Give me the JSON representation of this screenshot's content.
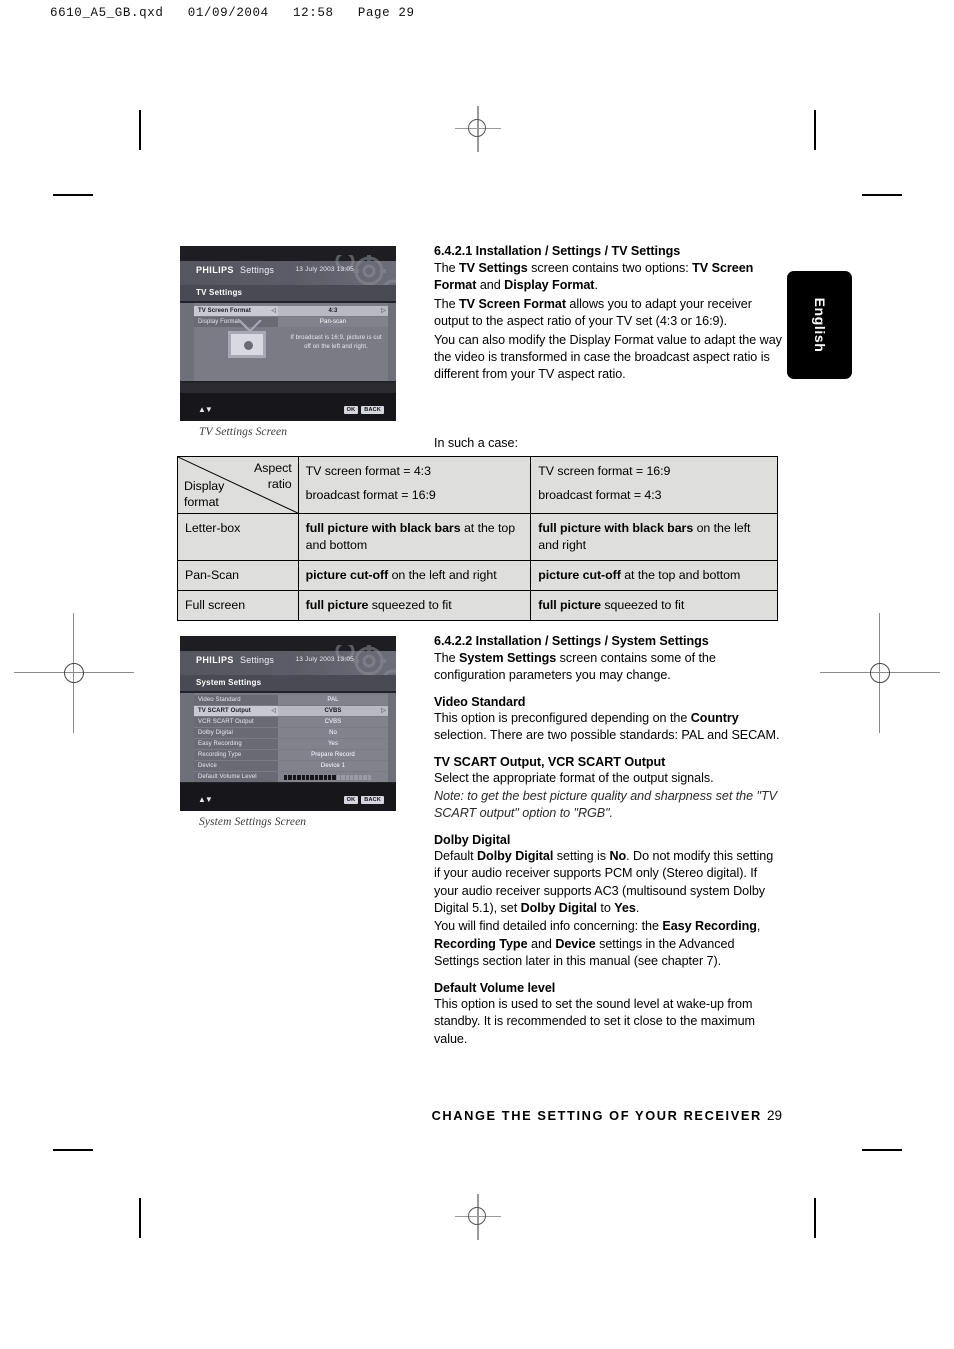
{
  "file_header": "6610_A5_GB.qxd   01/09/2004   12:58   Page 29",
  "side_tab": {
    "label": "English"
  },
  "screens": [
    {
      "brand": "PHILIPS",
      "brand_sub": "Settings",
      "datetime": "13 July 2003  13:05",
      "title": "TV Settings",
      "rows": [
        {
          "label": "TV Screen Format",
          "value": "4:3",
          "selected": true
        },
        {
          "label": "Display Format",
          "value": "Pan-scan",
          "selected": false
        }
      ],
      "hint": "If broadcast is 16:9, picture is cut off on the left and right.",
      "ok_label": "OK",
      "back_label": "BACK",
      "caption": "TV Settings Screen"
    },
    {
      "brand": "PHILIPS",
      "brand_sub": "Settings",
      "datetime": "13 July 2003  13:05",
      "title": "System Settings",
      "rows": [
        {
          "label": "Video Standard",
          "value": "PAL",
          "selected": false
        },
        {
          "label": "TV SCART Output",
          "value": "CVBS",
          "selected": true
        },
        {
          "label": "VCR SCART Output",
          "value": "CVBS",
          "selected": false
        },
        {
          "label": "Dolby Digital",
          "value": "No",
          "selected": false
        },
        {
          "label": "Easy Recording",
          "value": "Yes",
          "selected": false
        },
        {
          "label": "Recording Type",
          "value": "Prepare Record",
          "selected": false
        },
        {
          "label": "Device",
          "value": "Device 1",
          "selected": false
        },
        {
          "label": "Default Volume Level",
          "value": "",
          "selected": false,
          "meter": {
            "filled": 12,
            "total": 20
          }
        }
      ],
      "ok_label": "OK",
      "back_label": "BACK",
      "caption": "System Settings Screen"
    }
  ],
  "section_1": {
    "heading_number": "6.4.2.1",
    "heading_text": "Installation / Settings / TV Settings",
    "p1_a": "The ",
    "p1_b": "TV Settings",
    "p1_c": " screen contains two options: ",
    "p1_d": "TV Screen Format",
    "p1_e": " and ",
    "p1_f": "Display Format",
    "p1_g": ".",
    "p2_a": "The ",
    "p2_b": "TV Screen Format",
    "p2_c": " allows you to adapt your receiver output to the aspect ratio of your TV set (4:3 or 16:9).",
    "p3": "You can also modify the Display Format value to adapt the way the video is transformed in case the broadcast aspect ratio is different from your TV aspect ratio."
  },
  "in_such_a_case": "In such a case:",
  "table": {
    "corner": {
      "aspect": "Aspect\nratio",
      "display": "Display\nformat"
    },
    "col_headers": [
      {
        "line1": "TV screen format  =  4:3",
        "line2": "broadcast format  =  16:9"
      },
      {
        "line1": "TV screen format  =  16:9",
        "line2": "broadcast format  =  4:3"
      }
    ],
    "rows": [
      {
        "label": "Letter-box",
        "cell1_bold": "full picture with black bars",
        "cell1_rest": " at the top and bottom",
        "cell2_bold": "full picture with black bars",
        "cell2_rest": " on the left and right"
      },
      {
        "label": "Pan-Scan",
        "cell1_bold": "picture cut-off",
        "cell1_rest": " on the left and right",
        "cell2_bold": "picture cut-off",
        "cell2_rest": " at the top and bottom"
      },
      {
        "label": "Full screen",
        "cell1_bold": "full picture",
        "cell1_rest": " squeezed to fit",
        "cell2_bold": "full picture",
        "cell2_rest": " squeezed to fit"
      }
    ]
  },
  "section_2": {
    "heading_number": "6.4.2.2",
    "heading_text": "Installation / Settings / System Settings",
    "p1_a": "The ",
    "p1_b": "System Settings",
    "p1_c": " screen contains some of the configuration parameters you may change.",
    "h_video": "Video Standard",
    "video_a": "This option is preconfigured depending on the ",
    "video_b": "Country",
    "video_c": " selection. There are two possible standards: PAL and SECAM.",
    "h_scart": "TV SCART Output, VCR SCART Output",
    "scart_p": "Select the appropriate format of the output signals.",
    "scart_note": "Note: to get the best picture quality and sharpness set the \"TV SCART output\" option to \"RGB\".",
    "h_dolby": "Dolby Digital",
    "dolby_a": "Default ",
    "dolby_b": "Dolby Digital",
    "dolby_c": " setting is ",
    "dolby_d": "No",
    "dolby_e": ". Do not modify this setting if your audio receiver supports PCM only (Stereo digital). If your audio receiver supports AC3 (multisound system Dolby Digital 5.1), set ",
    "dolby_f": "Dolby Digital",
    "dolby_g": " to ",
    "dolby_h": "Yes",
    "dolby_i": ".",
    "adv_a": "You will find detailed info concerning: the ",
    "adv_b": "Easy Recording",
    "adv_c": ", ",
    "adv_d": "Recording Type",
    "adv_e": " and ",
    "adv_f": "Device",
    "adv_g": " settings in the Advanced Settings section later in this manual (see chapter 7).",
    "h_volume": "Default Volume level",
    "volume_p": "This option is used to set the sound level at wake-up from standby. It is recommended to set it close to the maximum value."
  },
  "footer": {
    "text": "CHANGE THE SETTING OF YOUR RECEIVER",
    "page": "29"
  },
  "colors": {
    "page_bg": "#ffffff",
    "table_bg": "#dededc",
    "tab_bg": "#000000",
    "screen_bg": "#6f6f79"
  }
}
